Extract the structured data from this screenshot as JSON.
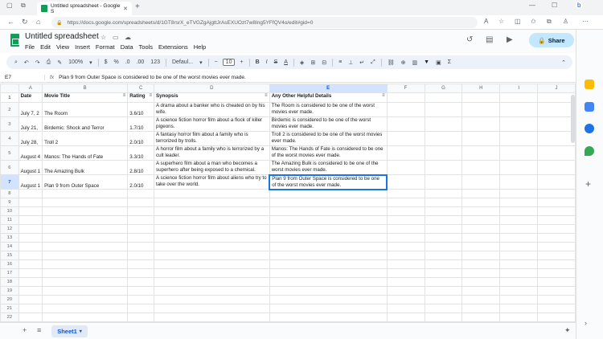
{
  "browser": {
    "tab_title": "Untitled spreadsheet - Google S",
    "tab_close": "✕",
    "new_tab": "+",
    "url": "https://docs.google.com/spreadsheets/d/1GT8rsrX_eTVGZgAjgttJrAsEXUOzt7w8Ing5YFfQV4o/edit#gid=0",
    "win_min": "—",
    "win_max": "☐",
    "win_close": "✕"
  },
  "app": {
    "title": "Untitled spreadsheet",
    "share_label": "Share",
    "menus": [
      "File",
      "Edit",
      "View",
      "Insert",
      "Format",
      "Data",
      "Tools",
      "Extensions",
      "Help"
    ]
  },
  "toolbar": {
    "zoom": "100%",
    "currency": "$",
    "percent": "%",
    "decimal_dec": ".0",
    "decimal_inc": ".00",
    "number_format": "123",
    "font": "Defaul...",
    "font_size": "10"
  },
  "formula_bar": {
    "cell_ref": "E7",
    "fx": "fx",
    "value": "Plan 9 from Outer Space is considered to be one of the worst movies ever made."
  },
  "grid": {
    "columns": [
      "A",
      "B",
      "C",
      "D",
      "E",
      "F",
      "G",
      "H",
      "I",
      "J"
    ],
    "row_numbers": [
      "1",
      "2",
      "3",
      "4",
      "5",
      "6",
      "7",
      "8",
      "9",
      "10",
      "11",
      "12",
      "13",
      "14",
      "15",
      "16",
      "17",
      "18",
      "19",
      "20",
      "21",
      "22",
      "23",
      "24",
      "25"
    ],
    "header": [
      "Date",
      "Movie Title",
      "Rating",
      "Synopsis",
      "Any Other Helpful Details"
    ],
    "rows": [
      [
        "July 7, 2",
        "The Room",
        "3.6/10",
        "A drama about a banker who is cheated on by his wife.",
        "The Room is considered to be one of the worst movies ever made."
      ],
      [
        "July 21,",
        "Birdemic: Shock and Terror",
        "1.7/10",
        "A science fiction horror film about a flock of killer pigeons.",
        "Birdemic is considered to be one of the worst movies ever made."
      ],
      [
        "July 28,",
        "Troll 2",
        "2.0/10",
        "A fantasy horror film about a family who is terrorized by trolls.",
        "Troll 2 is considered to be one of the worst movies ever made."
      ],
      [
        "August 4",
        "Manos: The Hands of Fate",
        "3.3/10",
        "A horror film about a family who is terrorized by a cult leader.",
        "Manos: The Hands of Fate is considered to be one of the worst movies ever made."
      ],
      [
        "August 1",
        "The Amazing Bulk",
        "2.8/10",
        "A superhero film about a man who becomes a superhero after being exposed to a chemical.",
        "The Amazing Bulk is considered to be one of the worst movies ever made."
      ],
      [
        "August 1",
        "Plan 9 from Outer Space",
        "2.0/10",
        "A science fiction horror film about aliens who try to take over the world.",
        "Plan 9 from Outer Space is considered to be one of the worst movies ever made."
      ]
    ]
  },
  "bottom": {
    "add_sheet": "+",
    "all_sheets": "≡",
    "sheet_tab": "Sheet1"
  },
  "colors": {
    "accent": "#1a73e8",
    "share_bg": "#c2e7ff",
    "selected_header": "#d3e3fd",
    "brand_green": "#0f9d58"
  }
}
